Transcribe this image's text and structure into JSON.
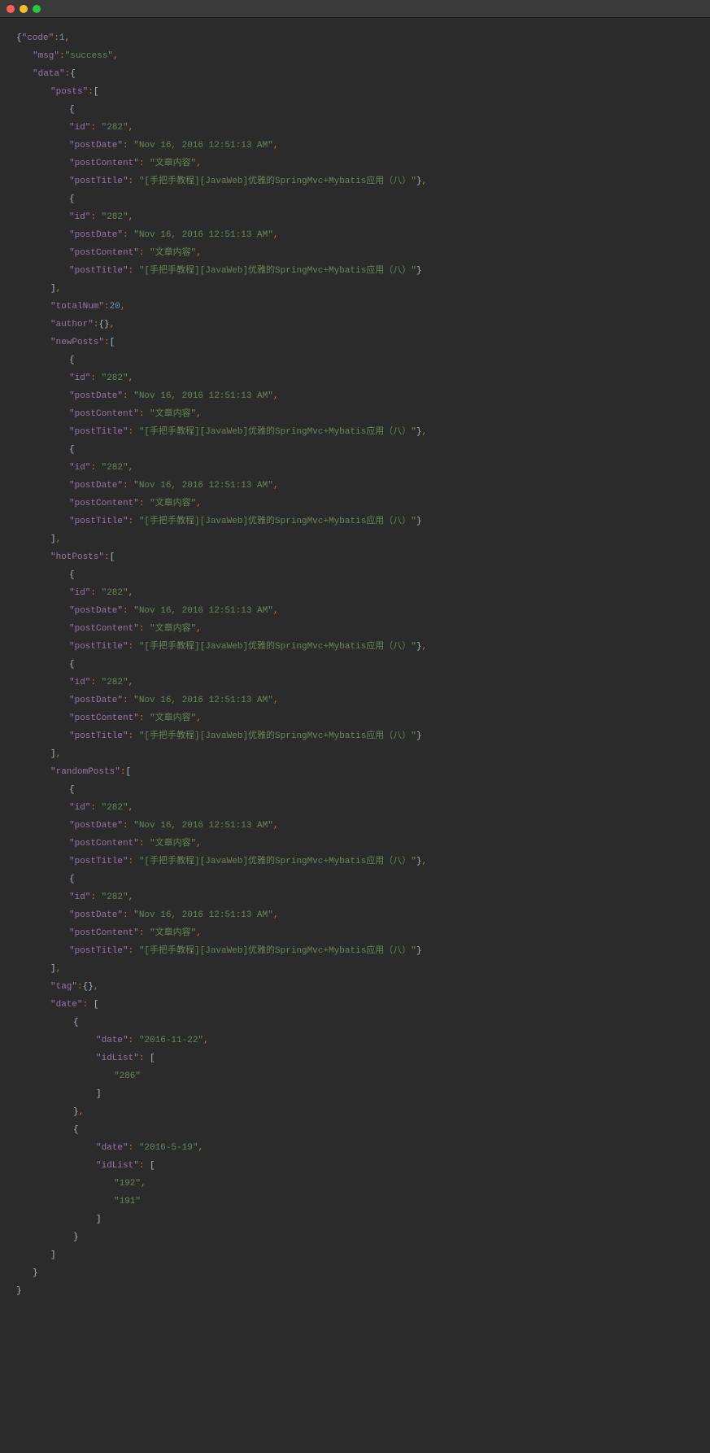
{
  "lines": [
    [
      0,
      [
        [
          "brace",
          "{"
        ],
        [
          "key",
          "\"code\""
        ],
        [
          "punc",
          ":"
        ],
        [
          "num",
          "1"
        ],
        [
          "punc",
          ","
        ]
      ]
    ],
    [
      1,
      [
        [
          "key",
          "\"msg\""
        ],
        [
          "punc",
          ":"
        ],
        [
          "str",
          "\"success\""
        ],
        [
          "punc",
          ","
        ]
      ]
    ],
    [
      1,
      [
        [
          "key",
          "\"data\""
        ],
        [
          "punc",
          ":"
        ],
        [
          "brace",
          "{"
        ]
      ]
    ],
    [
      2,
      [
        [
          "key",
          "\"posts\""
        ],
        [
          "punc",
          ":"
        ],
        [
          "brace",
          "["
        ]
      ]
    ],
    [
      3,
      [
        [
          "brace",
          "{"
        ]
      ]
    ],
    [
      3,
      [
        [
          "key",
          "\"id\""
        ],
        [
          "punc",
          ": "
        ],
        [
          "str",
          "\"282\""
        ],
        [
          "punc",
          ","
        ]
      ]
    ],
    [
      3,
      [
        [
          "key",
          "\"postDate\""
        ],
        [
          "punc",
          ": "
        ],
        [
          "str",
          "\"Nov 16, 2016 12:51:13 AM\""
        ],
        [
          "punc",
          ","
        ]
      ]
    ],
    [
      3,
      [
        [
          "key",
          "\"postContent\""
        ],
        [
          "punc",
          ": "
        ],
        [
          "str",
          "\"文章内容\""
        ],
        [
          "punc",
          ","
        ]
      ]
    ],
    [
      3,
      [
        [
          "key",
          "\"postTitle\""
        ],
        [
          "punc",
          ": "
        ],
        [
          "str",
          "\"[手把手教程][JavaWeb]优雅的SpringMvc+Mybatis应用（八）\""
        ],
        [
          "brace",
          "}"
        ],
        [
          "punc",
          ","
        ]
      ]
    ],
    [
      3,
      [
        [
          "brace",
          "{"
        ]
      ]
    ],
    [
      3,
      [
        [
          "key",
          "\"id\""
        ],
        [
          "punc",
          ": "
        ],
        [
          "str",
          "\"282\""
        ],
        [
          "punc",
          ","
        ]
      ]
    ],
    [
      3,
      [
        [
          "key",
          "\"postDate\""
        ],
        [
          "punc",
          ": "
        ],
        [
          "str",
          "\"Nov 16, 2016 12:51:13 AM\""
        ],
        [
          "punc",
          ","
        ]
      ]
    ],
    [
      3,
      [
        [
          "key",
          "\"postContent\""
        ],
        [
          "punc",
          ": "
        ],
        [
          "str",
          "\"文章内容\""
        ],
        [
          "punc",
          ","
        ]
      ]
    ],
    [
      3,
      [
        [
          "key",
          "\"postTitle\""
        ],
        [
          "punc",
          ": "
        ],
        [
          "str",
          "\"[手把手教程][JavaWeb]优雅的SpringMvc+Mybatis应用（八）\""
        ],
        [
          "brace",
          "}"
        ]
      ]
    ],
    [
      2,
      [
        [
          "brace",
          "]"
        ],
        [
          "punc",
          ","
        ]
      ]
    ],
    [
      2,
      [
        [
          "key",
          "\"totalNum\""
        ],
        [
          "punc",
          ":"
        ],
        [
          "num",
          "20"
        ],
        [
          "punc",
          ","
        ]
      ]
    ],
    [
      2,
      [
        [
          "key",
          "\"author\""
        ],
        [
          "punc",
          ":"
        ],
        [
          "brace",
          "{}"
        ],
        [
          "punc",
          ","
        ]
      ]
    ],
    [
      2,
      [
        [
          "key",
          "\"newPosts\""
        ],
        [
          "punc",
          ":"
        ],
        [
          "brace",
          "["
        ]
      ]
    ],
    [
      3,
      [
        [
          "brace",
          "{"
        ]
      ]
    ],
    [
      3,
      [
        [
          "key",
          "\"id\""
        ],
        [
          "punc",
          ": "
        ],
        [
          "str",
          "\"282\""
        ],
        [
          "punc",
          ","
        ]
      ]
    ],
    [
      3,
      [
        [
          "key",
          "\"postDate\""
        ],
        [
          "punc",
          ": "
        ],
        [
          "str",
          "\"Nov 16, 2016 12:51:13 AM\""
        ],
        [
          "punc",
          ","
        ]
      ]
    ],
    [
      3,
      [
        [
          "key",
          "\"postContent\""
        ],
        [
          "punc",
          ": "
        ],
        [
          "str",
          "\"文章内容\""
        ],
        [
          "punc",
          ","
        ]
      ]
    ],
    [
      3,
      [
        [
          "key",
          "\"postTitle\""
        ],
        [
          "punc",
          ": "
        ],
        [
          "str",
          "\"[手把手教程][JavaWeb]优雅的SpringMvc+Mybatis应用（八）\""
        ],
        [
          "brace",
          "}"
        ],
        [
          "punc",
          ","
        ]
      ]
    ],
    [
      3,
      [
        [
          "brace",
          "{"
        ]
      ]
    ],
    [
      3,
      [
        [
          "key",
          "\"id\""
        ],
        [
          "punc",
          ": "
        ],
        [
          "str",
          "\"282\""
        ],
        [
          "punc",
          ","
        ]
      ]
    ],
    [
      3,
      [
        [
          "key",
          "\"postDate\""
        ],
        [
          "punc",
          ": "
        ],
        [
          "str",
          "\"Nov 16, 2016 12:51:13 AM\""
        ],
        [
          "punc",
          ","
        ]
      ]
    ],
    [
      3,
      [
        [
          "key",
          "\"postContent\""
        ],
        [
          "punc",
          ": "
        ],
        [
          "str",
          "\"文章内容\""
        ],
        [
          "punc",
          ","
        ]
      ]
    ],
    [
      3,
      [
        [
          "key",
          "\"postTitle\""
        ],
        [
          "punc",
          ": "
        ],
        [
          "str",
          "\"[手把手教程][JavaWeb]优雅的SpringMvc+Mybatis应用（八）\""
        ],
        [
          "brace",
          "}"
        ]
      ]
    ],
    [
      2,
      [
        [
          "brace",
          "]"
        ],
        [
          "punc",
          ","
        ]
      ]
    ],
    [
      2,
      [
        [
          "key",
          "\"hotPosts\""
        ],
        [
          "punc",
          ":"
        ],
        [
          "brace",
          "["
        ]
      ]
    ],
    [
      3,
      [
        [
          "brace",
          "{"
        ]
      ]
    ],
    [
      3,
      [
        [
          "key",
          "\"id\""
        ],
        [
          "punc",
          ": "
        ],
        [
          "str",
          "\"282\""
        ],
        [
          "punc",
          ","
        ]
      ]
    ],
    [
      3,
      [
        [
          "key",
          "\"postDate\""
        ],
        [
          "punc",
          ": "
        ],
        [
          "str",
          "\"Nov 16, 2016 12:51:13 AM\""
        ],
        [
          "punc",
          ","
        ]
      ]
    ],
    [
      3,
      [
        [
          "key",
          "\"postContent\""
        ],
        [
          "punc",
          ": "
        ],
        [
          "str",
          "\"文章内容\""
        ],
        [
          "punc",
          ","
        ]
      ]
    ],
    [
      3,
      [
        [
          "key",
          "\"postTitle\""
        ],
        [
          "punc",
          ": "
        ],
        [
          "str",
          "\"[手把手教程][JavaWeb]优雅的SpringMvc+Mybatis应用（八）\""
        ],
        [
          "brace",
          "}"
        ],
        [
          "punc",
          ","
        ]
      ]
    ],
    [
      3,
      [
        [
          "brace",
          "{"
        ]
      ]
    ],
    [
      3,
      [
        [
          "key",
          "\"id\""
        ],
        [
          "punc",
          ": "
        ],
        [
          "str",
          "\"282\""
        ],
        [
          "punc",
          ","
        ]
      ]
    ],
    [
      3,
      [
        [
          "key",
          "\"postDate\""
        ],
        [
          "punc",
          ": "
        ],
        [
          "str",
          "\"Nov 16, 2016 12:51:13 AM\""
        ],
        [
          "punc",
          ","
        ]
      ]
    ],
    [
      3,
      [
        [
          "key",
          "\"postContent\""
        ],
        [
          "punc",
          ": "
        ],
        [
          "str",
          "\"文章内容\""
        ],
        [
          "punc",
          ","
        ]
      ]
    ],
    [
      3,
      [
        [
          "key",
          "\"postTitle\""
        ],
        [
          "punc",
          ": "
        ],
        [
          "str",
          "\"[手把手教程][JavaWeb]优雅的SpringMvc+Mybatis应用（八）\""
        ],
        [
          "brace",
          "}"
        ]
      ]
    ],
    [
      2,
      [
        [
          "brace",
          "]"
        ],
        [
          "punc",
          ","
        ]
      ]
    ],
    [
      2,
      [
        [
          "key",
          "\"randomPosts\""
        ],
        [
          "punc",
          ":"
        ],
        [
          "brace",
          "["
        ]
      ]
    ],
    [
      3,
      [
        [
          "brace",
          "{"
        ]
      ]
    ],
    [
      3,
      [
        [
          "key",
          "\"id\""
        ],
        [
          "punc",
          ": "
        ],
        [
          "str",
          "\"282\""
        ],
        [
          "punc",
          ","
        ]
      ]
    ],
    [
      3,
      [
        [
          "key",
          "\"postDate\""
        ],
        [
          "punc",
          ": "
        ],
        [
          "str",
          "\"Nov 16, 2016 12:51:13 AM\""
        ],
        [
          "punc",
          ","
        ]
      ]
    ],
    [
      3,
      [
        [
          "key",
          "\"postContent\""
        ],
        [
          "punc",
          ": "
        ],
        [
          "str",
          "\"文章内容\""
        ],
        [
          "punc",
          ","
        ]
      ]
    ],
    [
      3,
      [
        [
          "key",
          "\"postTitle\""
        ],
        [
          "punc",
          ": "
        ],
        [
          "str",
          "\"[手把手教程][JavaWeb]优雅的SpringMvc+Mybatis应用（八）\""
        ],
        [
          "brace",
          "}"
        ],
        [
          "punc",
          ","
        ]
      ]
    ],
    [
      3,
      [
        [
          "brace",
          "{"
        ]
      ]
    ],
    [
      3,
      [
        [
          "key",
          "\"id\""
        ],
        [
          "punc",
          ": "
        ],
        [
          "str",
          "\"282\""
        ],
        [
          "punc",
          ","
        ]
      ]
    ],
    [
      3,
      [
        [
          "key",
          "\"postDate\""
        ],
        [
          "punc",
          ": "
        ],
        [
          "str",
          "\"Nov 16, 2016 12:51:13 AM\""
        ],
        [
          "punc",
          ","
        ]
      ]
    ],
    [
      3,
      [
        [
          "key",
          "\"postContent\""
        ],
        [
          "punc",
          ": "
        ],
        [
          "str",
          "\"文章内容\""
        ],
        [
          "punc",
          ","
        ]
      ]
    ],
    [
      3,
      [
        [
          "key",
          "\"postTitle\""
        ],
        [
          "punc",
          ": "
        ],
        [
          "str",
          "\"[手把手教程][JavaWeb]优雅的SpringMvc+Mybatis应用（八）\""
        ],
        [
          "brace",
          "}"
        ]
      ]
    ],
    [
      2,
      [
        [
          "brace",
          "]"
        ],
        [
          "punc",
          ","
        ]
      ]
    ],
    [
      2,
      [
        [
          "key",
          "\"tag\""
        ],
        [
          "punc",
          ":"
        ],
        [
          "brace",
          "{}"
        ],
        [
          "punc",
          ","
        ]
      ]
    ],
    [
      2,
      [
        [
          "key",
          "\"date\""
        ],
        [
          "punc",
          ": "
        ],
        [
          "brace",
          "["
        ]
      ]
    ],
    [
      4,
      [
        [
          "brace",
          "{"
        ]
      ]
    ],
    [
      5,
      [
        [
          "key",
          "\"date\""
        ],
        [
          "punc",
          ": "
        ],
        [
          "str",
          "\"2016-11-22\""
        ],
        [
          "punc",
          ","
        ]
      ]
    ],
    [
      5,
      [
        [
          "key",
          "\"idList\""
        ],
        [
          "punc",
          ": "
        ],
        [
          "brace",
          "["
        ]
      ]
    ],
    [
      6,
      [
        [
          "str",
          "\"286\""
        ]
      ]
    ],
    [
      5,
      [
        [
          "brace",
          "]"
        ]
      ]
    ],
    [
      4,
      [
        [
          "brace",
          "}"
        ],
        [
          "punc",
          ","
        ]
      ]
    ],
    [
      4,
      [
        [
          "brace",
          "{"
        ]
      ]
    ],
    [
      5,
      [
        [
          "key",
          "\"date\""
        ],
        [
          "punc",
          ": "
        ],
        [
          "str",
          "\"2016-5-19\""
        ],
        [
          "punc",
          ","
        ]
      ]
    ],
    [
      5,
      [
        [
          "key",
          "\"idList\""
        ],
        [
          "punc",
          ": "
        ],
        [
          "brace",
          "["
        ]
      ]
    ],
    [
      6,
      [
        [
          "str",
          "\"192\""
        ],
        [
          "punc",
          ","
        ]
      ]
    ],
    [
      6,
      [
        [
          "str",
          "\"191\""
        ]
      ]
    ],
    [
      5,
      [
        [
          "brace",
          "]"
        ]
      ]
    ],
    [
      4,
      [
        [
          "brace",
          "}"
        ]
      ]
    ],
    [
      2,
      [
        [
          "brace",
          "]"
        ]
      ]
    ],
    [
      1,
      [
        [
          "brace",
          "}"
        ]
      ]
    ],
    [
      0,
      [
        [
          "brace",
          "}"
        ]
      ]
    ]
  ]
}
